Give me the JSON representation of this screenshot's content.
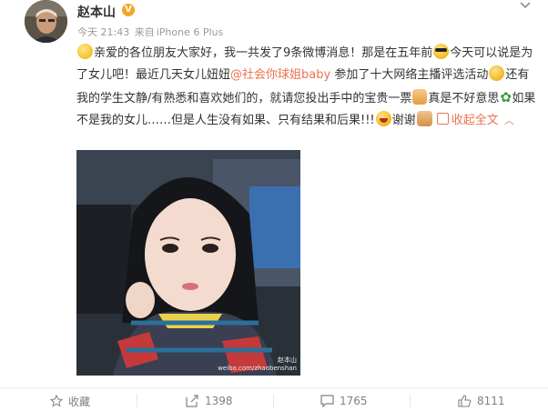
{
  "post": {
    "user_name": "赵本山",
    "verified_badge": "V",
    "time": "今天 21:43",
    "source_prefix": "来自",
    "source": "iPhone 6 Plus",
    "text_segments": {
      "s1": "亲爱的各位朋友大家好，我一共发了9条微博消息！那是在五年前",
      "s2": "今天可以说是为了女儿吧！最近几天女儿妞妞",
      "mention": "@社会你球姐baby",
      "s3": " 参加了十大网络主播评选活动",
      "s4": "还有我的学生文静/有熟悉和喜欢她们的，就请您投出手中的宝贵一票",
      "s5": "真是不好意思",
      "s6": "如果不是我的女儿……但是人生没有如果、只有结果和后果!!!",
      "s7": "谢谢",
      "collapse": "收起全文"
    },
    "emojis": [
      "smile-emoji",
      "sunglasses-emoji",
      "shy-emoji",
      "thumbs-up-emoji",
      "grass-emoji",
      "laugh-emoji",
      "clap-emoji"
    ],
    "photo_watermark_name": "赵本山",
    "photo_watermark_url": "weibo.com/zhaobenshan"
  },
  "actions": {
    "favorite_label": "收藏",
    "repost_count": "1398",
    "comment_count": "1765",
    "like_count": "8111"
  },
  "colors": {
    "link": "#eb7350",
    "badge": "#f5a623",
    "meta": "#999999"
  }
}
